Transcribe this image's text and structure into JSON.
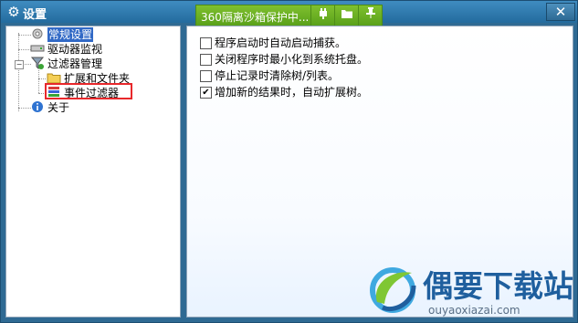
{
  "window": {
    "title": "设置",
    "close_label": "✕"
  },
  "sandbox": {
    "label": "360隔离沙箱保护中...",
    "icons": [
      "plugin-icon",
      "folder-icon",
      "pin-icon"
    ]
  },
  "tree": {
    "items": [
      {
        "label": "常规设置",
        "icon": "gear-icon",
        "selected": true
      },
      {
        "label": "驱动器监视",
        "icon": "drive-icon"
      },
      {
        "label": "过滤器管理",
        "icon": "filter-icon",
        "expanded": true,
        "children": [
          {
            "label": "扩展和文件夹",
            "icon": "folder-icon"
          },
          {
            "label": "事件过滤器",
            "icon": "event-filter-icon"
          }
        ]
      },
      {
        "label": "关于",
        "icon": "info-icon"
      }
    ]
  },
  "options": [
    {
      "label": "程序启动时自动启动捕获。",
      "checked": false
    },
    {
      "label": "关闭程序时最小化到系统托盘。",
      "checked": false
    },
    {
      "label": "停止记录时清除树/列表。",
      "checked": false
    },
    {
      "label": "增加新的结果时，自动扩展树。",
      "checked": true
    }
  ],
  "watermark": {
    "brand": "偶要下载站",
    "url": "ouyaoxiazai.com"
  },
  "colors": {
    "titlebar": "#2f6a93",
    "selection": "#3169c6",
    "sandbox": "#6cb126",
    "highlight": "#e8282b"
  }
}
